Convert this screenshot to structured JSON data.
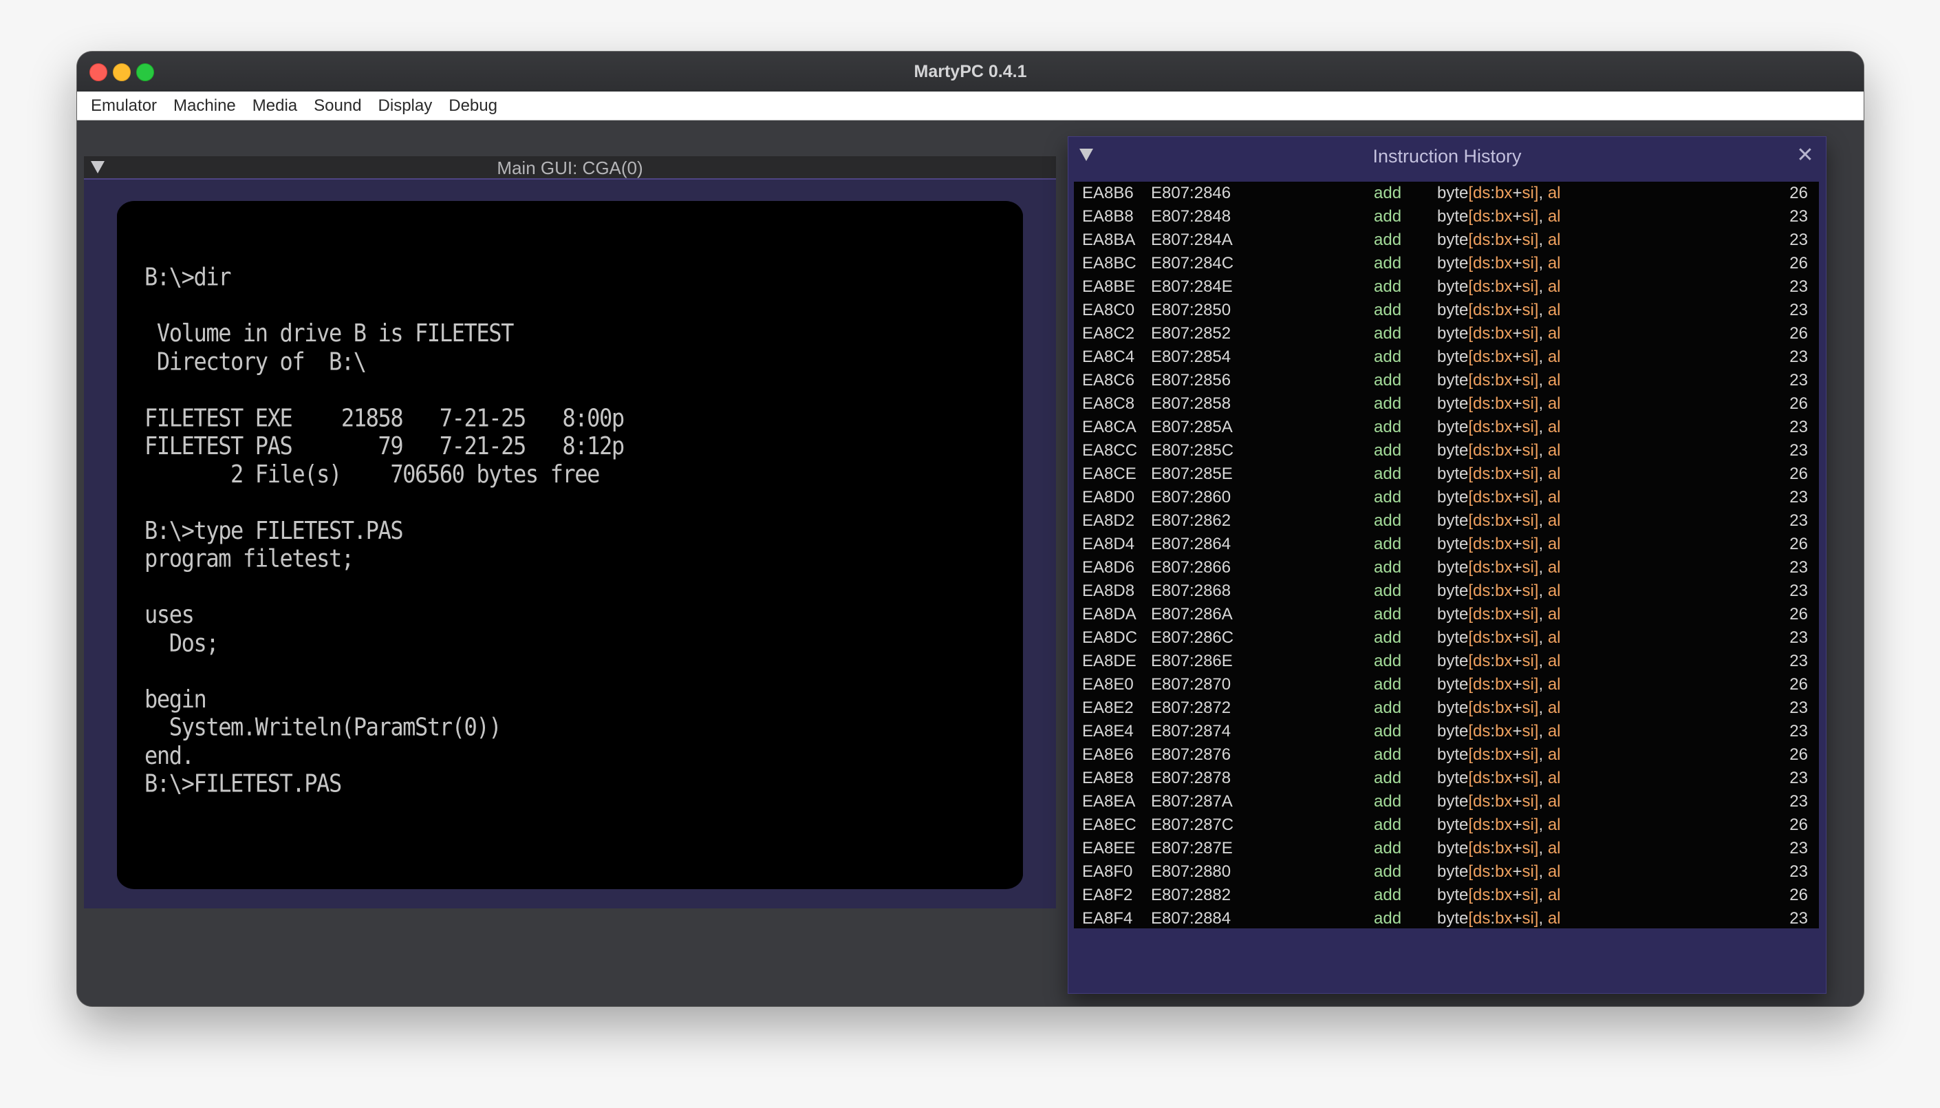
{
  "window": {
    "title": "MartyPC 0.4.1"
  },
  "menu": [
    "Emulator",
    "Machine",
    "Media",
    "Sound",
    "Display",
    "Debug"
  ],
  "main_panel": {
    "title": "Main GUI: CGA(0)",
    "screen_text": "B:\\>dir\n\n Volume in drive B is FILETEST\n Directory of  B:\\\n\nFILETEST EXE    21858   7-21-25   8:00p\nFILETEST PAS       79   7-21-25   8:12p\n       2 File(s)    706560 bytes free\n\nB:\\>type FILETEST.PAS\nprogram filetest;\n\nuses\n  Dos;\n\nbegin\n  System.Writeln(ParamStr(0))\nend.\nB:\\>FILETEST.PAS"
  },
  "history_panel": {
    "title": "Instruction History",
    "colors": {
      "mnemonic": "#a4dc9a",
      "register": "#f0a15e",
      "text": "#d8d8d8"
    },
    "rows": [
      {
        "addr": "EA8B6",
        "seg": "E807:2846",
        "mnemonic": "add",
        "cycles": "26"
      },
      {
        "addr": "EA8B8",
        "seg": "E807:2848",
        "mnemonic": "add",
        "cycles": "23"
      },
      {
        "addr": "EA8BA",
        "seg": "E807:284A",
        "mnemonic": "add",
        "cycles": "23"
      },
      {
        "addr": "EA8BC",
        "seg": "E807:284C",
        "mnemonic": "add",
        "cycles": "26"
      },
      {
        "addr": "EA8BE",
        "seg": "E807:284E",
        "mnemonic": "add",
        "cycles": "23"
      },
      {
        "addr": "EA8C0",
        "seg": "E807:2850",
        "mnemonic": "add",
        "cycles": "23"
      },
      {
        "addr": "EA8C2",
        "seg": "E807:2852",
        "mnemonic": "add",
        "cycles": "26"
      },
      {
        "addr": "EA8C4",
        "seg": "E807:2854",
        "mnemonic": "add",
        "cycles": "23"
      },
      {
        "addr": "EA8C6",
        "seg": "E807:2856",
        "mnemonic": "add",
        "cycles": "23"
      },
      {
        "addr": "EA8C8",
        "seg": "E807:2858",
        "mnemonic": "add",
        "cycles": "26"
      },
      {
        "addr": "EA8CA",
        "seg": "E807:285A",
        "mnemonic": "add",
        "cycles": "23"
      },
      {
        "addr": "EA8CC",
        "seg": "E807:285C",
        "mnemonic": "add",
        "cycles": "23"
      },
      {
        "addr": "EA8CE",
        "seg": "E807:285E",
        "mnemonic": "add",
        "cycles": "26"
      },
      {
        "addr": "EA8D0",
        "seg": "E807:2860",
        "mnemonic": "add",
        "cycles": "23"
      },
      {
        "addr": "EA8D2",
        "seg": "E807:2862",
        "mnemonic": "add",
        "cycles": "23"
      },
      {
        "addr": "EA8D4",
        "seg": "E807:2864",
        "mnemonic": "add",
        "cycles": "26"
      },
      {
        "addr": "EA8D6",
        "seg": "E807:2866",
        "mnemonic": "add",
        "cycles": "23"
      },
      {
        "addr": "EA8D8",
        "seg": "E807:2868",
        "mnemonic": "add",
        "cycles": "23"
      },
      {
        "addr": "EA8DA",
        "seg": "E807:286A",
        "mnemonic": "add",
        "cycles": "26"
      },
      {
        "addr": "EA8DC",
        "seg": "E807:286C",
        "mnemonic": "add",
        "cycles": "23"
      },
      {
        "addr": "EA8DE",
        "seg": "E807:286E",
        "mnemonic": "add",
        "cycles": "23"
      },
      {
        "addr": "EA8E0",
        "seg": "E807:2870",
        "mnemonic": "add",
        "cycles": "26"
      },
      {
        "addr": "EA8E2",
        "seg": "E807:2872",
        "mnemonic": "add",
        "cycles": "23"
      },
      {
        "addr": "EA8E4",
        "seg": "E807:2874",
        "mnemonic": "add",
        "cycles": "23"
      },
      {
        "addr": "EA8E6",
        "seg": "E807:2876",
        "mnemonic": "add",
        "cycles": "26"
      },
      {
        "addr": "EA8E8",
        "seg": "E807:2878",
        "mnemonic": "add",
        "cycles": "23"
      },
      {
        "addr": "EA8EA",
        "seg": "E807:287A",
        "mnemonic": "add",
        "cycles": "23"
      },
      {
        "addr": "EA8EC",
        "seg": "E807:287C",
        "mnemonic": "add",
        "cycles": "26"
      },
      {
        "addr": "EA8EE",
        "seg": "E807:287E",
        "mnemonic": "add",
        "cycles": "23"
      },
      {
        "addr": "EA8F0",
        "seg": "E807:2880",
        "mnemonic": "add",
        "cycles": "23"
      },
      {
        "addr": "EA8F2",
        "seg": "E807:2882",
        "mnemonic": "add",
        "cycles": "26"
      },
      {
        "addr": "EA8F4",
        "seg": "E807:2884",
        "mnemonic": "add",
        "cycles": "23"
      }
    ],
    "operand_tokens": [
      {
        "text": "byte",
        "kind": "plain"
      },
      {
        "text": "[",
        "kind": "reg"
      },
      {
        "text": "ds",
        "kind": "reg"
      },
      {
        "text": ":",
        "kind": "plain"
      },
      {
        "text": "bx",
        "kind": "reg"
      },
      {
        "text": "+",
        "kind": "plain"
      },
      {
        "text": "si",
        "kind": "reg"
      },
      {
        "text": "]",
        "kind": "reg"
      },
      {
        "text": ", ",
        "kind": "plain"
      },
      {
        "text": "al",
        "kind": "reg"
      }
    ]
  }
}
